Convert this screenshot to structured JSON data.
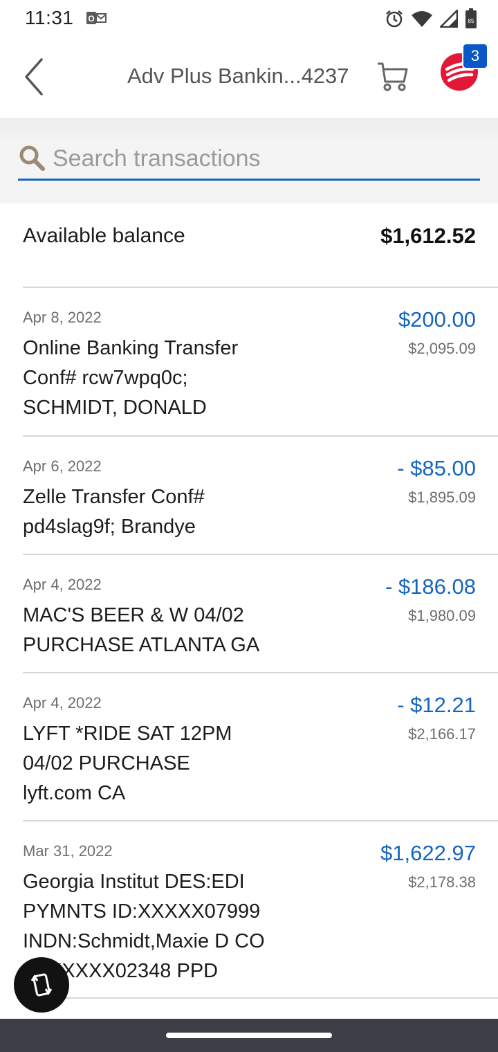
{
  "status_bar": {
    "time": "11:31",
    "battery_level": "85",
    "icons": [
      "outlook-icon",
      "alarm-icon",
      "wifi-icon",
      "signal-icon",
      "battery-icon"
    ]
  },
  "header": {
    "title": "Adv Plus Bankin...4237",
    "badge_count": "3",
    "icons": [
      "back-chevron-icon",
      "cart-icon",
      "bank-logo-icon"
    ]
  },
  "search": {
    "placeholder": "Search transactions"
  },
  "balance": {
    "label": "Available balance",
    "value": "$1,612.52"
  },
  "transactions": [
    {
      "date": "Apr 8, 2022",
      "description": "Online Banking Transfer\nConf# rcw7wpq0c;\nSCHMIDT, DONALD",
      "amount": "$200.00",
      "running_balance": "$2,095.09"
    },
    {
      "date": "Apr 6, 2022",
      "description": "Zelle Transfer Conf#\npd4slag9f; Brandye",
      "amount": "- $85.00",
      "running_balance": "$1,895.09"
    },
    {
      "date": "Apr 4, 2022",
      "description": "MAC'S BEER & W 04/02\nPURCHASE ATLANTA GA",
      "amount": "- $186.08",
      "running_balance": "$1,980.09"
    },
    {
      "date": "Apr 4, 2022",
      "description": "LYFT *RIDE SAT 12PM\n04/02 PURCHASE\nlyft.com CA",
      "amount": "- $12.21",
      "running_balance": "$2,166.17"
    },
    {
      "date": "Mar 31, 2022",
      "description": "Georgia Institut DES:EDI\nPYMNTS ID:XXXXX07999\nINDN:Schmidt,Maxie D CO\nID:XXXXX02348 PPD",
      "amount": "$1,622.97",
      "running_balance": "$2,178.38"
    }
  ],
  "colors": {
    "accent_blue": "#1565c0",
    "badge_blue": "#0a58c7",
    "logo_red": "#e31837",
    "nav_bar": "#3c3f45"
  }
}
